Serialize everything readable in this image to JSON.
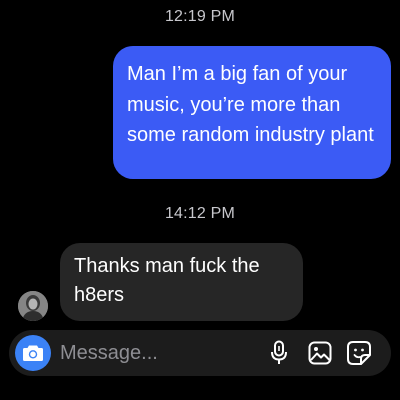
{
  "conversation": {
    "messages": [
      {
        "timestamp": "12:19 PM",
        "direction": "outgoing",
        "text": "Man I’m a big fan of your music, you’re more than some random industry plant"
      },
      {
        "timestamp": "14:12 PM",
        "direction": "incoming",
        "text": "Thanks man fuck the h8ers"
      }
    ]
  },
  "composer": {
    "placeholder": "Message...",
    "icons": [
      "camera-icon",
      "microphone-icon",
      "gallery-icon",
      "sticker-icon"
    ]
  },
  "colors": {
    "outgoing_bubble": "#3b5bf5",
    "incoming_bubble": "#262626",
    "camera_button": "#3b82f6",
    "background": "#000000"
  }
}
